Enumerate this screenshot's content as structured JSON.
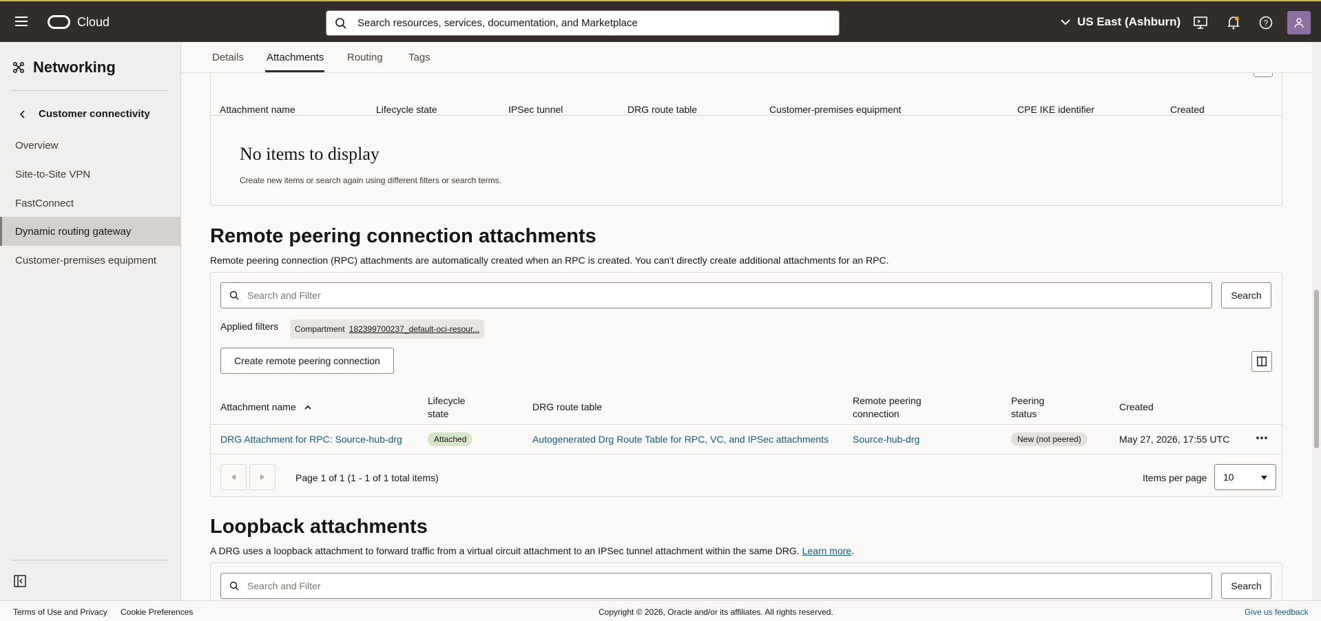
{
  "header": {
    "brand": "Cloud",
    "search_text": "Search resources, services, documentation, and Marketplace",
    "region": "US East (Ashburn)"
  },
  "sidebar": {
    "title": "Networking",
    "back_label": "Customer connectivity",
    "items": [
      {
        "label": "Overview"
      },
      {
        "label": "Site-to-Site VPN"
      },
      {
        "label": "FastConnect"
      },
      {
        "label": "Dynamic routing gateway"
      },
      {
        "label": "Customer-premises equipment"
      }
    ],
    "active_item": "Dynamic routing gateway"
  },
  "tabs": [
    "Details",
    "Attachments",
    "Routing",
    "Tags"
  ],
  "active_tab": "Attachments",
  "ipsec_table": {
    "columns": [
      "Attachment name",
      "Lifecycle state",
      "IPSec tunnel",
      "DRG route table",
      "Customer-premises equipment",
      "CPE IKE identifier",
      "Created"
    ],
    "empty_title": "No items to display",
    "empty_sub": "Create new items or search again using different filters or search terms."
  },
  "rpc": {
    "title": "Remote peering connection attachments",
    "description": "Remote peering connection (RPC) attachments are automatically created when an RPC is created. You can't directly create additional attachments for an RPC.",
    "search_placeholder": "Search and Filter",
    "search_button": "Search",
    "applied_filters_label": "Applied filters",
    "chip_label": "Compartment",
    "chip_value": "182399700237_default-oci-resour...",
    "create_button": "Create remote peering connection",
    "columns": {
      "name": "Attachment name",
      "lifecycle_1": "Lifecycle",
      "lifecycle_2": "state",
      "route_table": "DRG route table",
      "remote_1": "Remote peering",
      "remote_2": "connection",
      "peering_1": "Peering",
      "peering_2": "status",
      "created": "Created"
    },
    "row": {
      "name": "DRG Attachment for RPC: Source-hub-drg",
      "state": "Attached",
      "route_table": "Autogenerated Drg Route Table for RPC, VC, and IPSec attachments",
      "remote": "Source-hub-drg",
      "peering": "New (not peered)",
      "created": "May 27, 2026, 17:55 UTC"
    },
    "page_info": "Page 1 of 1 (1 - 1 of 1 total items)",
    "items_per_page_label": "Items per page",
    "items_per_page": "10"
  },
  "loopback": {
    "title": "Loopback attachments",
    "description": "A DRG uses a loopback attachment to forward traffic from a virtual circuit attachment to an IPSec tunnel attachment within the same DRG.",
    "learn_more": "Learn more",
    "search_placeholder": "Search and Filter",
    "search_button": "Search"
  },
  "footer": {
    "terms": "Terms of Use and Privacy",
    "cookies": "Cookie Preferences",
    "copyright": "Copyright © 2026, Oracle and/or its affiliates. All rights reserved.",
    "feedback": "Give us feedback"
  },
  "colors": {
    "header_bg": "#312d2a",
    "link": "#0f5c87",
    "attached_badge": "#d7e6c8",
    "peering_badge": "#e4e1dd"
  }
}
